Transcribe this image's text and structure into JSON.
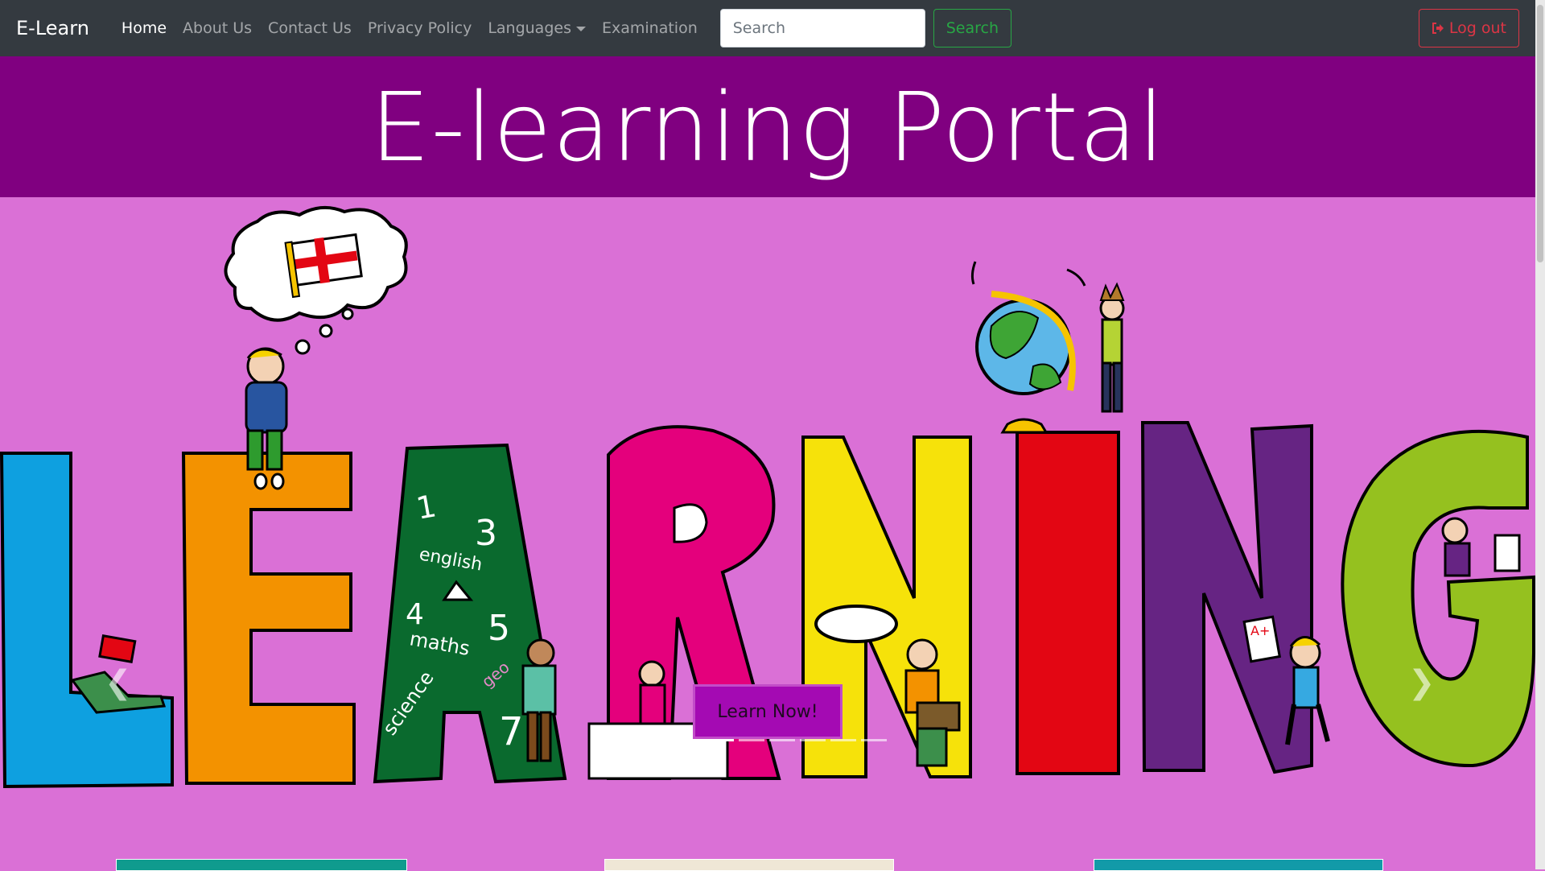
{
  "navbar": {
    "brand": "E-Learn",
    "links": [
      "Home",
      "About Us",
      "Contact Us",
      "Privacy Policy",
      "Languages",
      "Examination"
    ],
    "search_placeholder": "Search",
    "search_button": "Search",
    "logout": "Log out"
  },
  "header": {
    "title": "E-learning Portal"
  },
  "carousel": {
    "button": "Learn Now!",
    "slide_text": {
      "n1": "1",
      "n3": "3",
      "english": "english",
      "n4": "4",
      "n5": "5",
      "maths": "maths",
      "science": "science",
      "n7": "7",
      "geo": "geo",
      "grade": "A+"
    }
  },
  "colors": {
    "navbar": "#343a40",
    "header": "#800080",
    "carousel_bg": "#da70d6",
    "search_green": "#28a745",
    "logout_red": "#dc3545",
    "learn_button": "#a40ab3"
  }
}
